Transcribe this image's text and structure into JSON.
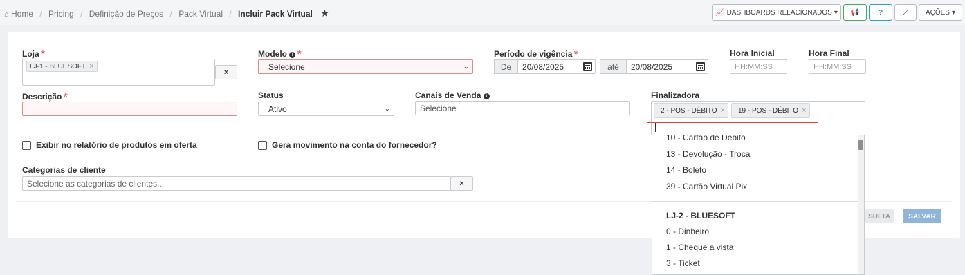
{
  "breadcrumb": {
    "home": "Home",
    "items": [
      "Pricing",
      "Definição de Preços",
      "Pack Virtual"
    ],
    "current": "Incluir Pack Virtual"
  },
  "toolbar": {
    "dashboards": "DASHBOARDS RELACIONADOS",
    "acoes": "AÇÕES"
  },
  "form": {
    "loja": {
      "label": "Loja",
      "tag": "LJ-1 - BLUESOFT",
      "clear": "×"
    },
    "modelo": {
      "label": "Modelo",
      "value": "Selecione"
    },
    "periodo": {
      "label": "Período de vigência",
      "de": "De",
      "start": "20/08/2025",
      "ate": "até",
      "end": "20/08/2025"
    },
    "hora_inicial": {
      "label": "Hora Inicial",
      "placeholder": "HH:MM:SS"
    },
    "hora_final": {
      "label": "Hora Final",
      "placeholder": "HH:MM:SS"
    },
    "descricao": {
      "label": "Descrição",
      "value": ""
    },
    "status": {
      "label": "Status",
      "value": "Ativo"
    },
    "canais": {
      "label": "Canais de Venda",
      "placeholder": "Selecione"
    },
    "finalizadora": {
      "label": "Finalizadora",
      "tags": [
        "2 - POS - DÉBITO",
        "19 - POS - DÉBITO"
      ]
    },
    "checkbox_relatorio": "Exibir no relatório de produtos em oferta",
    "checkbox_movimento": "Gera movimento na conta do fornecedor?",
    "categorias": {
      "label": "Categorias de cliente",
      "placeholder": "Selecione as categorias de clientes...",
      "clear": "×"
    }
  },
  "dropdown": {
    "group1": [
      "10 - Cartão de Débito",
      "13 - Devolução - Troca",
      "14 - Boleto",
      "39 - Cartão Virtual Pix"
    ],
    "group2_label": "LJ-2 - BLUESOFT",
    "group2": [
      "0 - Dinheiro",
      "1 - Cheque a vista",
      "3 - Ticket"
    ]
  },
  "actions": {
    "consulta": "SULTA",
    "salvar": "SALVAR"
  },
  "colors": {
    "required": "#d9534f",
    "primary_disabled": "#8fb6d9",
    "highlight": "#e0442f"
  }
}
